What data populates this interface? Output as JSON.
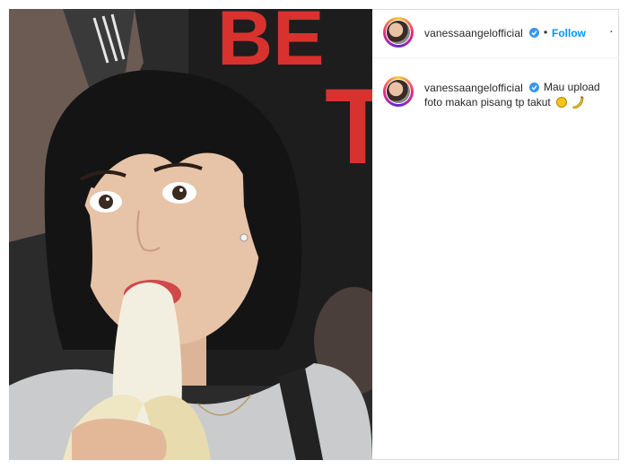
{
  "post": {
    "image": {
      "alt": "",
      "poster_letters": [
        "BE",
        "T"
      ],
      "colors": {
        "poster_red": "#d8322f",
        "hair": "#1a1a1a",
        "skin": "#e7c3a8",
        "shirt": "#c9cbcd",
        "banana": "#f3efe0",
        "lips": "#d0484a"
      }
    },
    "header": {
      "username": "vanessaangelofficial",
      "separator": "•",
      "follow_label": "Follow",
      "more_label": "···"
    },
    "caption": {
      "username": "vanessaangelofficial",
      "text_line1": "Mau upload",
      "text_line2": "foto makan pisang tp takut"
    },
    "icons": {
      "verified": "verified-badge-icon",
      "face_emoji": "worried-face-emoji",
      "banana_emoji": "banana-emoji"
    },
    "accent": {
      "follow": "#0095f6",
      "verified": "#3897f0"
    }
  }
}
